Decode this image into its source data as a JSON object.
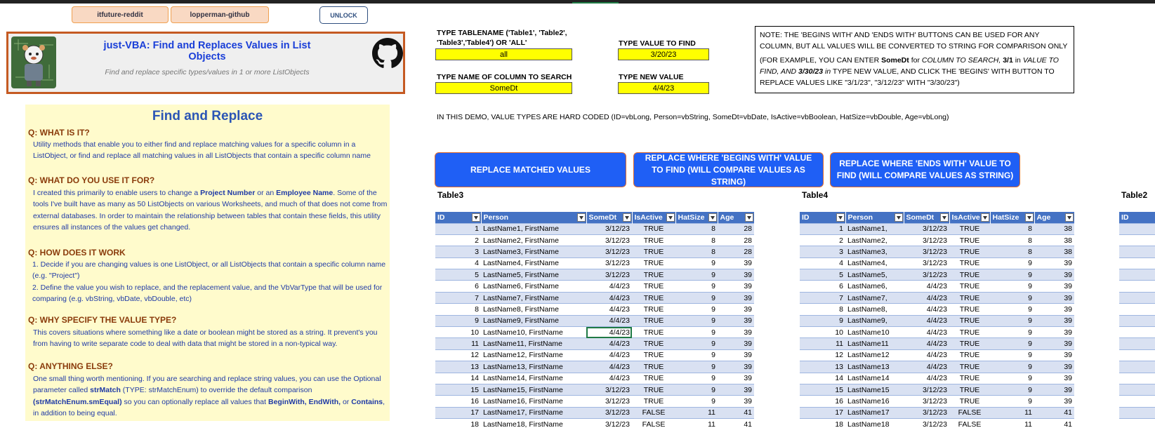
{
  "links": {
    "reddit": "itfuture-reddit",
    "github": "lopperman-github",
    "unlock": "UNLOCK"
  },
  "banner": {
    "title": "just-VBA: Find and Replaces Values in List Objects",
    "subtitle": "Find and replace specific types/values in 1 or more ListObjects"
  },
  "info": {
    "title": "Find and Replace",
    "q1": "Q: WHAT IS IT?",
    "a1": "Utility methods that enable you to either find and replace matching values for a specific column in a ListObject, or find and replace all matching values in all ListObjects that contain a specific column name",
    "q2": "Q: WHAT DO YOU USE IT FOR?",
    "a2_pre": "I created this primarily to enable users to change a ",
    "a2_b1": "Project Number",
    "a2_mid": " or an ",
    "a2_b2": "Employee Name",
    "a2_post": ".  Some of the tools I've built have as many as 50 ListObjects on various Worksheets, and much of that does not come from external databases.  In order to maintain the relationship between tables that contain these fields, this utility ensures all instances of the values get changed.",
    "q3": "Q: HOW DOES IT WORK",
    "a3_1": "1. Decide if you are changing values is one ListObject, or all ListObjects that contain a specific column name (e.g. \"Project\")",
    "a3_2": "2. Define the value you wish to replace, and the replacement value, and the VbVarType that will be used for comparing (e.g. vbString, vbDate, vbDouble, etc)",
    "q4": "Q: WHY SPECIFY THE VALUE TYPE?",
    "a4": "This covers situations where something like a date or boolean might be stored as a string.  It prevent's you from having to write separate code to deal with data that might be stored in a non-typical way.",
    "q5": "Q: ANYTHING ELSE?",
    "a5_1": "One small thing worth mentioning.  If you are searching and replace string values, you can use the Optional parameter called ",
    "a5_b1": "strMatch",
    "a5_2": " (TYPE: strMatchEnum) to override the default comparison ",
    "a5_b2": "(strMatchEnum.smEqual)",
    "a5_3": " so you can optionally replace all values that ",
    "a5_b3": "BeginWith, EndWith,",
    "a5_4": " or ",
    "a5_b4": "Contains",
    "a5_5": ", in addition to being equal."
  },
  "inputs": {
    "table_label": "TYPE TABLENAME ('Table1', 'Table2', 'Table3','Table4') OR 'ALL'",
    "table_value": "all",
    "column_label": "TYPE NAME OF COLUMN TO SEARCH",
    "column_value": "SomeDt",
    "find_label": "TYPE VALUE TO FIND",
    "find_value": "3/20/23",
    "new_label": "TYPE NEW VALUE",
    "new_value": "4/4/23"
  },
  "note": {
    "line1": "NOTE: THE 'BEGINS WITH' AND 'ENDS WITH' BUTTONS CAN BE USED FOR ANY COLUMN, BUT ALL VALUES WILL BE CONVERTED TO STRING FOR COMPARISON ONLY",
    "p1": "(FOR EXAMPLE, YOU CAN ENTER ",
    "b1": "SomeDt",
    "p2": " for ",
    "i1": "COLUMN TO SEARCH,",
    "b2": " 3/1",
    "p3": " in ",
    "i2": "VALUE TO FIND, AND ",
    "b3": "3/30/23",
    "i3": " in",
    "p4": " TYPE NEW VALUE, AND CLICK THE 'BEGINS' WITH BUTTON TO REPLACE VALUES LIKE \"3/1/23\", \"3/12/23\" WITH \"3/30/23\")"
  },
  "demo_text": "IN THIS DEMO, VALUE TYPES ARE HARD CODED (ID=vbLong, Person=vbString, SomeDt=vbDate, IsActive=vbBoolean, HatSize=vbDouble, Age=vbLong)",
  "buttons": {
    "replace": "REPLACE MATCHED VALUES",
    "begins": "REPLACE WHERE 'BEGINS WITH' VALUE TO FIND (WILL COMPARE VALUES AS STRING)",
    "ends": "REPLACE WHERE 'ENDS WITH' VALUE TO FIND (WILL COMPARE VALUES AS STRING)"
  },
  "columns": [
    "ID",
    "Person",
    "SomeDt",
    "IsActive",
    "HatSize",
    "Age"
  ],
  "table3": {
    "name": "Table3",
    "rows": [
      [
        "1",
        "LastName1, FirstName",
        "3/12/23",
        "TRUE",
        "8",
        "28"
      ],
      [
        "2",
        "LastName2, FirstName",
        "3/12/23",
        "TRUE",
        "8",
        "28"
      ],
      [
        "3",
        "LastName3, FirstName",
        "3/12/23",
        "TRUE",
        "8",
        "28"
      ],
      [
        "4",
        "LastName4, FirstName",
        "3/12/23",
        "TRUE",
        "9",
        "39"
      ],
      [
        "5",
        "LastName5, FirstName",
        "3/12/23",
        "TRUE",
        "9",
        "39"
      ],
      [
        "6",
        "LastName6, FirstName",
        "4/4/23",
        "TRUE",
        "9",
        "39"
      ],
      [
        "7",
        "LastName7, FirstName",
        "4/4/23",
        "TRUE",
        "9",
        "39"
      ],
      [
        "8",
        "LastName8, FirstName",
        "4/4/23",
        "TRUE",
        "9",
        "39"
      ],
      [
        "9",
        "LastName9, FirstName",
        "4/4/23",
        "TRUE",
        "9",
        "39"
      ],
      [
        "10",
        "LastName10, FirstName",
        "4/4/23",
        "TRUE",
        "9",
        "39"
      ],
      [
        "11",
        "LastName11, FirstName",
        "4/4/23",
        "TRUE",
        "9",
        "39"
      ],
      [
        "12",
        "LastName12, FirstName",
        "4/4/23",
        "TRUE",
        "9",
        "39"
      ],
      [
        "13",
        "LastName13, FirstName",
        "4/4/23",
        "TRUE",
        "9",
        "39"
      ],
      [
        "14",
        "LastName14, FirstName",
        "4/4/23",
        "TRUE",
        "9",
        "39"
      ],
      [
        "15",
        "LastName15, FirstName",
        "3/12/23",
        "TRUE",
        "9",
        "39"
      ],
      [
        "16",
        "LastName16, FirstName",
        "3/12/23",
        "TRUE",
        "9",
        "39"
      ],
      [
        "17",
        "LastName17, FirstName",
        "3/12/23",
        "FALSE",
        "11",
        "41"
      ],
      [
        "18",
        "LastName18, FirstName",
        "3/12/23",
        "FALSE",
        "11",
        "41"
      ]
    ]
  },
  "table4": {
    "name": "Table4",
    "rows": [
      [
        "1",
        "LastName1,",
        "3/12/23",
        "TRUE",
        "8",
        "38"
      ],
      [
        "2",
        "LastName2,",
        "3/12/23",
        "TRUE",
        "8",
        "38"
      ],
      [
        "3",
        "LastName3,",
        "3/12/23",
        "TRUE",
        "8",
        "38"
      ],
      [
        "4",
        "LastName4,",
        "3/12/23",
        "TRUE",
        "9",
        "39"
      ],
      [
        "5",
        "LastName5,",
        "3/12/23",
        "TRUE",
        "9",
        "39"
      ],
      [
        "6",
        "LastName6,",
        "4/4/23",
        "TRUE",
        "9",
        "39"
      ],
      [
        "7",
        "LastName7,",
        "4/4/23",
        "TRUE",
        "9",
        "39"
      ],
      [
        "8",
        "LastName8,",
        "4/4/23",
        "TRUE",
        "9",
        "39"
      ],
      [
        "9",
        "LastName9,",
        "4/4/23",
        "TRUE",
        "9",
        "39"
      ],
      [
        "10",
        "LastName10",
        "4/4/23",
        "TRUE",
        "9",
        "39"
      ],
      [
        "11",
        "LastName11",
        "4/4/23",
        "TRUE",
        "9",
        "39"
      ],
      [
        "12",
        "LastName12",
        "4/4/23",
        "TRUE",
        "9",
        "39"
      ],
      [
        "13",
        "LastName13",
        "4/4/23",
        "TRUE",
        "9",
        "39"
      ],
      [
        "14",
        "LastName14",
        "4/4/23",
        "TRUE",
        "9",
        "39"
      ],
      [
        "15",
        "LastName15",
        "3/12/23",
        "TRUE",
        "9",
        "39"
      ],
      [
        "16",
        "LastName16",
        "3/12/23",
        "TRUE",
        "9",
        "39"
      ],
      [
        "17",
        "LastName17",
        "3/12/23",
        "FALSE",
        "11",
        "41"
      ],
      [
        "18",
        "LastName18",
        "3/12/23",
        "FALSE",
        "11",
        "41"
      ]
    ]
  },
  "table2": {
    "name": "Table2",
    "first_header": "ID"
  },
  "colors": {
    "accent_blue": "#1f5ff5",
    "header_blue": "#4472c4",
    "input_yellow": "#ffff00",
    "banner_border": "#c55a22",
    "info_bg": "#fffbcc"
  }
}
